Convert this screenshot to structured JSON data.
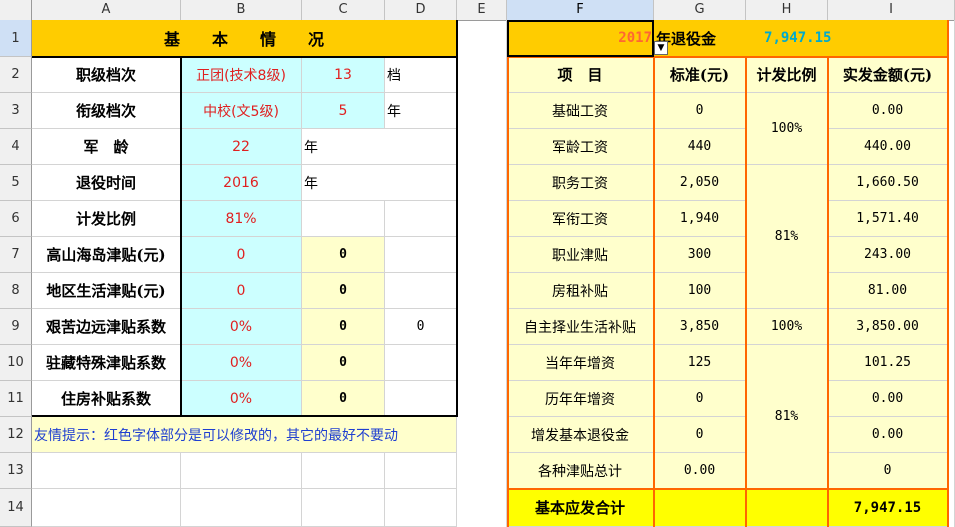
{
  "columns": [
    "A",
    "B",
    "C",
    "D",
    "E",
    "F",
    "G",
    "H",
    "I"
  ],
  "rows": [
    "1",
    "2",
    "3",
    "4",
    "5",
    "6",
    "7",
    "8",
    "9",
    "10",
    "11",
    "12",
    "13",
    "14"
  ],
  "left": {
    "title": "基　　本　　情　　况",
    "rank_label": "职级档次",
    "rank_value": "正团(技术8级)",
    "rank_grade": "13",
    "rank_unit": "档",
    "mil_rank_label": "衔级档次",
    "mil_rank_value": "中校(文5级)",
    "mil_rank_grade": "5",
    "mil_rank_unit": "年",
    "service_label": "军　龄",
    "service_value": "22",
    "service_unit": "年",
    "retire_label": "退役时间",
    "retire_value": "2016",
    "retire_unit": "年",
    "ratio_label": "计发比例",
    "ratio_value": "81%",
    "mountain_label": "高山海岛津贴(元)",
    "mountain_value": "0",
    "mountain_calc": "0",
    "region_label": "地区生活津贴(元)",
    "region_value": "0",
    "region_calc": "0",
    "remote_label": "艰苦边远津贴系数",
    "remote_value": "0%",
    "remote_calc": "0",
    "remote_extra": "0",
    "tibet_label": "驻藏特殊津贴系数",
    "tibet_value": "0%",
    "tibet_calc": "0",
    "housing_label": "住房补贴系数",
    "housing_value": "0%",
    "housing_calc": "0",
    "tip": "友情提示：红色字体部分是可以修改的，其它的最好不要动"
  },
  "right": {
    "year": "2017",
    "year_title": "年退役金",
    "total_top": "7,947.15",
    "headers": [
      "项　目",
      "标准(元)",
      "计发比例",
      "实发金额(元)"
    ],
    "items": [
      {
        "name": "基础工资",
        "std": "0",
        "amount": "0.00"
      },
      {
        "name": "军龄工资",
        "std": "440",
        "amount": "440.00"
      },
      {
        "name": "职务工资",
        "std": "2,050",
        "amount": "1,660.50"
      },
      {
        "name": "军衔工资",
        "std": "1,940",
        "amount": "1,571.40"
      },
      {
        "name": "职业津贴",
        "std": "300",
        "amount": "243.00"
      },
      {
        "name": "房租补贴",
        "std": "100",
        "amount": "81.00"
      },
      {
        "name": "自主择业生活补贴",
        "std": "3,850",
        "amount": "3,850.00"
      },
      {
        "name": "当年年增资",
        "std": "125",
        "amount": "101.25"
      },
      {
        "name": "历年年增资",
        "std": "0",
        "amount": "0.00"
      },
      {
        "name": "增发基本退役金",
        "std": "0",
        "amount": "0.00"
      },
      {
        "name": "各种津贴总计",
        "std": "0.00",
        "amount": "0"
      }
    ],
    "ratio_a": "100%",
    "ratio_b": "81%",
    "ratio_c": "100%",
    "ratio_d": "81%",
    "total_label": "基本应发合计",
    "total_value": "7,947.15"
  },
  "colors": {
    "cyan": "#ccffff",
    "yellow_light": "#ffffcc",
    "orange": "#ffcc00",
    "yellow": "#ffff00",
    "border_orange": "#ff6600"
  }
}
